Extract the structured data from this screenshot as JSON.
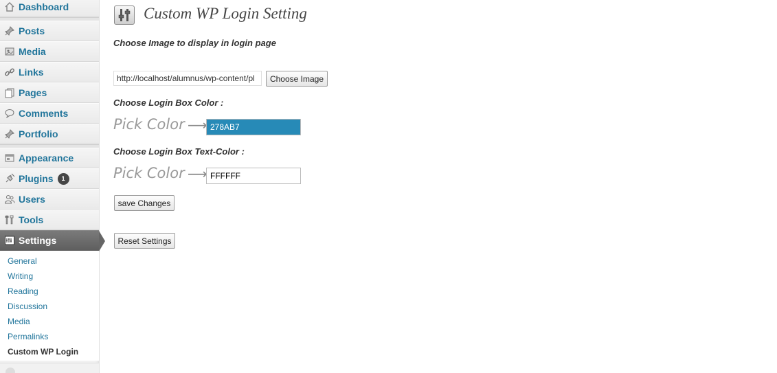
{
  "sidebar": {
    "items": [
      {
        "label": "Dashboard",
        "icon": "dashboard-icon"
      },
      {
        "label": "Posts",
        "icon": "pin-icon"
      },
      {
        "label": "Media",
        "icon": "media-icon"
      },
      {
        "label": "Links",
        "icon": "link-icon"
      },
      {
        "label": "Pages",
        "icon": "pages-icon"
      },
      {
        "label": "Comments",
        "icon": "comment-icon"
      },
      {
        "label": "Portfolio",
        "icon": "pin-icon"
      },
      {
        "label": "Appearance",
        "icon": "appearance-icon"
      },
      {
        "label": "Plugins",
        "icon": "plugin-icon",
        "badge": "1"
      },
      {
        "label": "Users",
        "icon": "users-icon"
      },
      {
        "label": "Tools",
        "icon": "tools-icon"
      },
      {
        "label": "Settings",
        "icon": "settings-icon",
        "current": true
      }
    ],
    "submenu": [
      "General",
      "Writing",
      "Reading",
      "Discussion",
      "Media",
      "Permalinks",
      "Custom WP Login"
    ],
    "active_submenu": "Custom WP Login"
  },
  "main": {
    "title": "Custom WP Login Setting",
    "image_section_label": "Choose Image to display in login page",
    "image_url_value": "http://localhost/alumnus/wp-content/pl",
    "choose_image_label": "Choose Image",
    "box_color_label": "Choose Login Box Color :",
    "pick_color_label": "Pick Color",
    "arrow": "⟶",
    "box_color_value": "278AB7",
    "text_color_label": "Choose Login Box Text-Color :",
    "text_color_value": "FFFFFF",
    "save_label": "save Changes",
    "reset_label": "Reset Settings"
  },
  "colors": {
    "link": "#21759b",
    "box_color_swatch": "#278ab7",
    "text_color_swatch": "#ffffff"
  }
}
